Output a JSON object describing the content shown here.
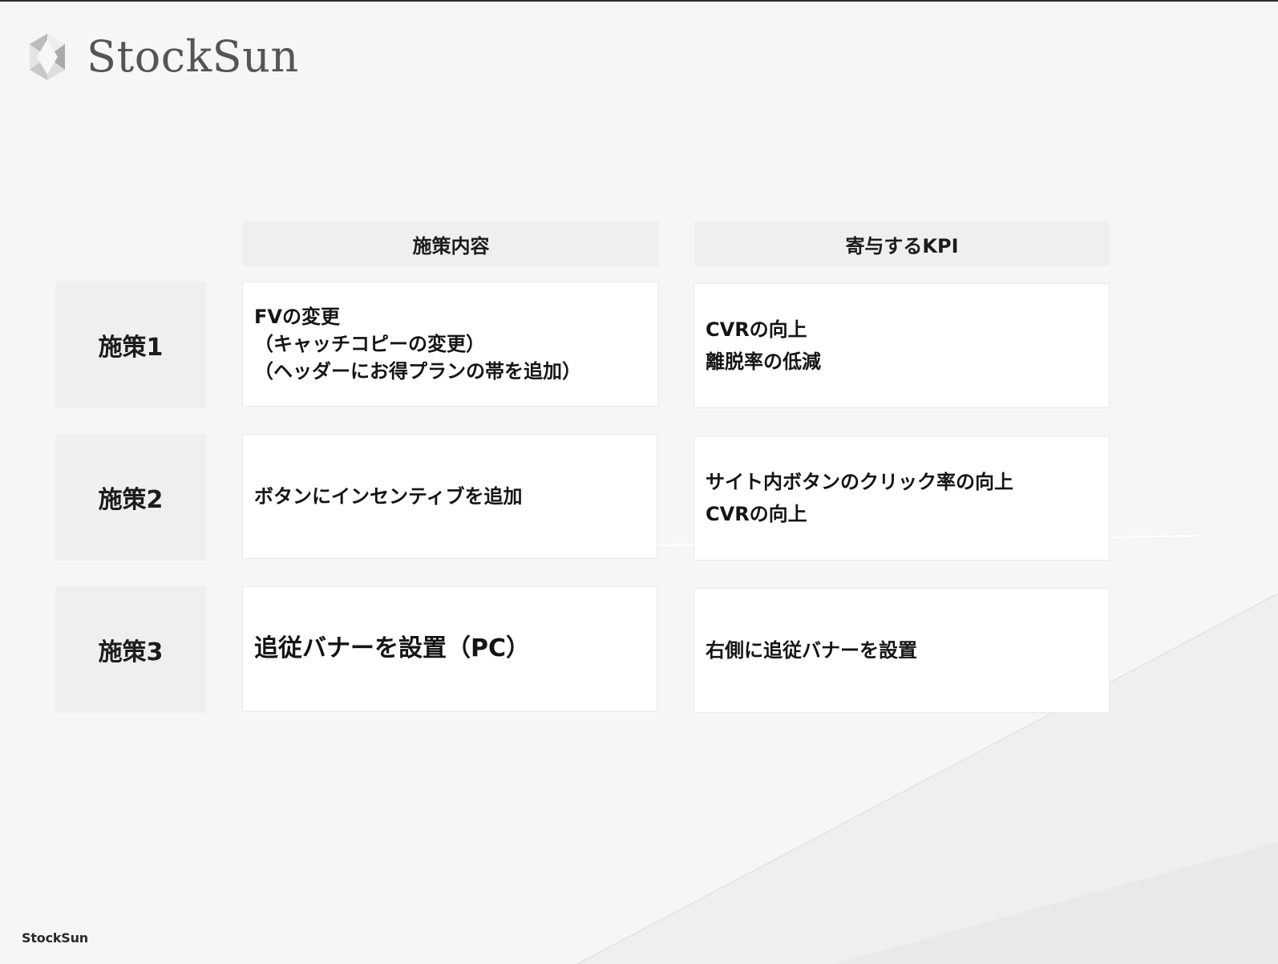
{
  "brand": {
    "logo_text": "StockSun",
    "footer_text": "StockSun"
  },
  "table": {
    "headers": {
      "content": "施策内容",
      "kpi": "寄与するKPI"
    },
    "rows": [
      {
        "label": "施策1",
        "content_lines": [
          "FVの変更",
          "（キャッチコピーの変更）",
          "（ヘッダーにお得プランの帯を追加）"
        ],
        "kpi_lines": [
          "CVRの向上",
          "離脱率の低減"
        ]
      },
      {
        "label": "施策2",
        "content_lines": [
          "ボタンにインセンティブを追加"
        ],
        "kpi_lines": [
          "サイト内ボタンのクリック率の向上",
          "CVRの向上"
        ]
      },
      {
        "label": "施策3",
        "content_lines": [
          "追従バナーを設置（PC）"
        ],
        "kpi_lines": [
          "右側に追従バナーを設置"
        ]
      }
    ]
  },
  "colors": {
    "background": "#f6f6f6",
    "header_fill": "#efefef",
    "cell_fill": "#ffffff",
    "text": "#111111",
    "logo_text": "#555555"
  },
  "icons": {
    "logo": "hexagon-crystal-icon"
  }
}
